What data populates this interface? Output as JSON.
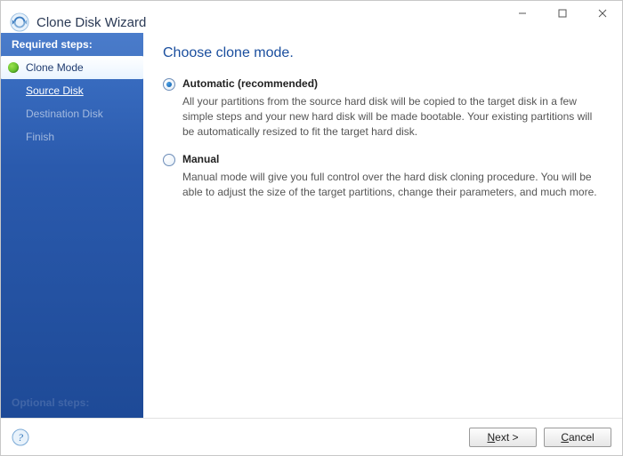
{
  "window": {
    "title": "Clone Disk Wizard"
  },
  "sidebar": {
    "header": "Required steps:",
    "steps": [
      {
        "label": "Clone Mode"
      },
      {
        "label": "Source Disk"
      },
      {
        "label": "Destination Disk"
      },
      {
        "label": "Finish"
      }
    ],
    "footer": "Optional steps:"
  },
  "main": {
    "title": "Choose clone mode.",
    "options": [
      {
        "label": "Automatic (recommended)",
        "description": "All your partitions from the source hard disk will be copied to the target disk in a few simple steps and your new hard disk will be made bootable. Your existing partitions will be automatically resized to fit the target hard disk."
      },
      {
        "label": "Manual",
        "description": "Manual mode will give you full control over the hard disk cloning procedure. You will be able to adjust the size of the target partitions, change their parameters, and much more."
      }
    ]
  },
  "footer": {
    "next": "Next >",
    "cancel": "Cancel"
  }
}
